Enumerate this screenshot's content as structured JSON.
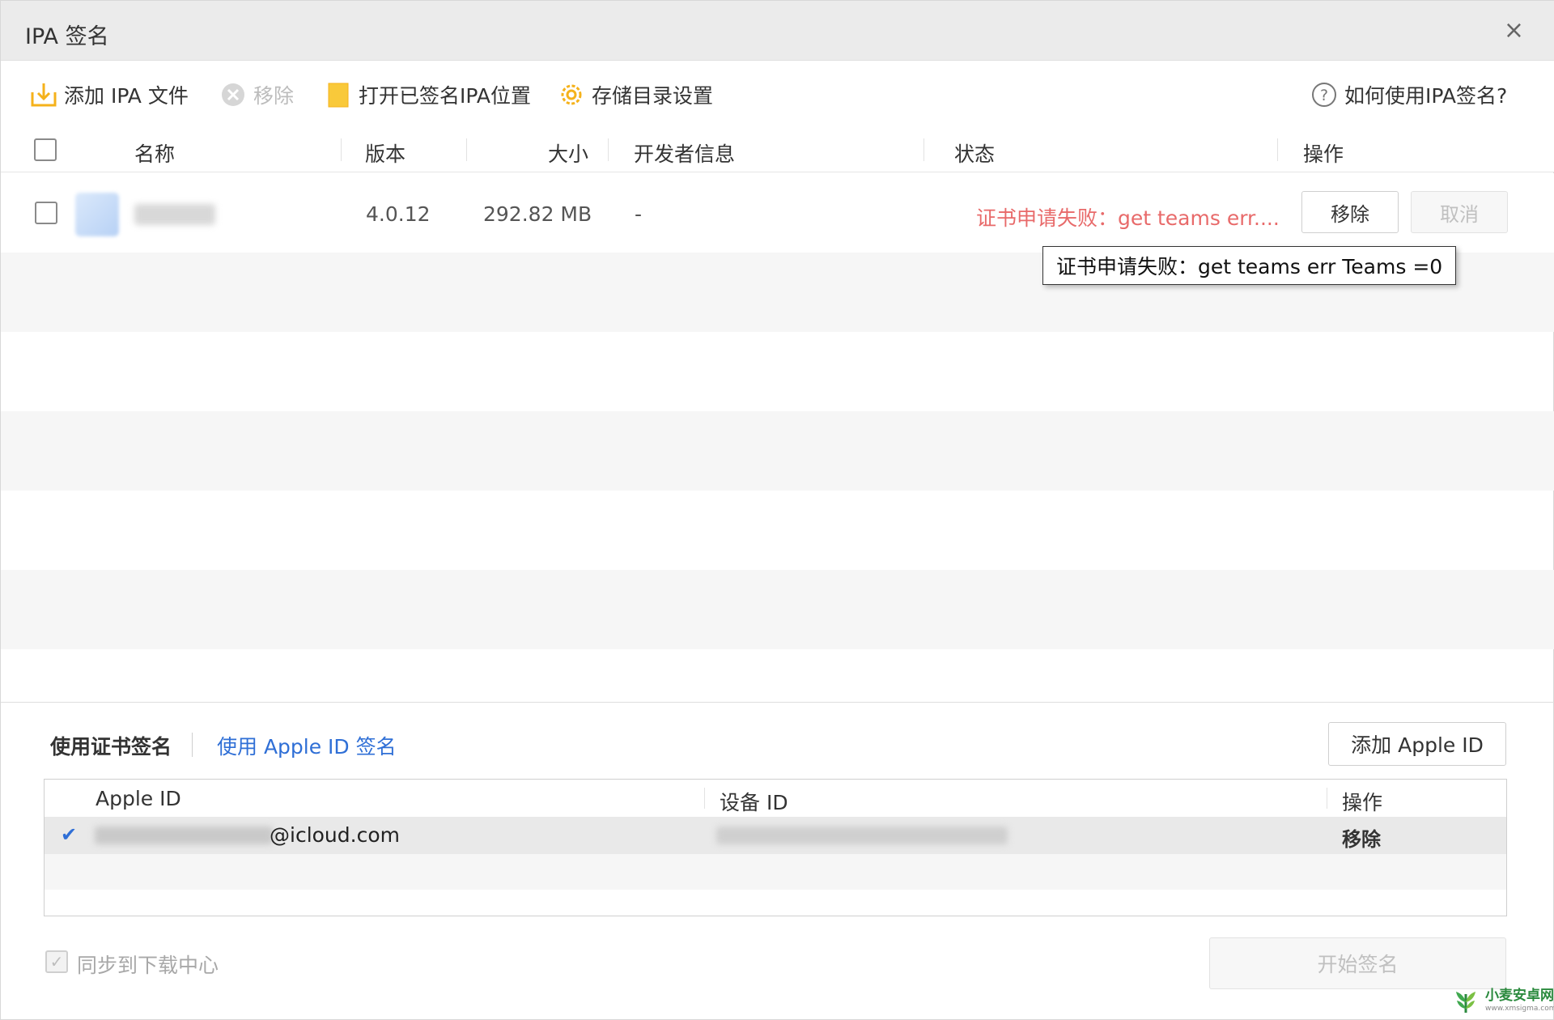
{
  "window": {
    "title": "IPA 签名",
    "close_label": "×"
  },
  "toolbar": {
    "add_ipa": "添加 IPA 文件",
    "remove": "移除",
    "open_signed": "打开已签名IPA位置",
    "storage_settings": "存储目录设置",
    "help": "如何使用IPA签名?"
  },
  "file_table": {
    "columns": [
      "名称",
      "版本",
      "大小",
      "开发者信息",
      "状态",
      "操作"
    ],
    "rows": [
      {
        "version": "4.0.12",
        "size": "292.82 MB",
        "developer": "-",
        "status": "证书申请失败：get teams err....",
        "remove_label": "移除",
        "cancel_label": "取消"
      }
    ]
  },
  "tooltip": {
    "text": "证书申请失败：get teams err Teams =0"
  },
  "sign_tabs": {
    "cert": "使用证书签名",
    "apple_id": "使用 Apple ID 签名",
    "add_apple_id": "添加 Apple ID"
  },
  "apple_id_table": {
    "columns": [
      "Apple ID",
      "设备 ID",
      "操作"
    ],
    "rows": [
      {
        "selected": true,
        "email_suffix": "@icloud.com",
        "action": "移除"
      }
    ]
  },
  "footer": {
    "sync_label": "同步到下载中心",
    "sync_checked": true,
    "start_sign": "开始签名"
  },
  "watermark": {
    "name": "小麦安卓网",
    "url": "www.xmsigma.com"
  },
  "colors": {
    "link": "#2f6fd6",
    "error": "#e86a6a",
    "toolbar_icon": "#f5b21b"
  }
}
